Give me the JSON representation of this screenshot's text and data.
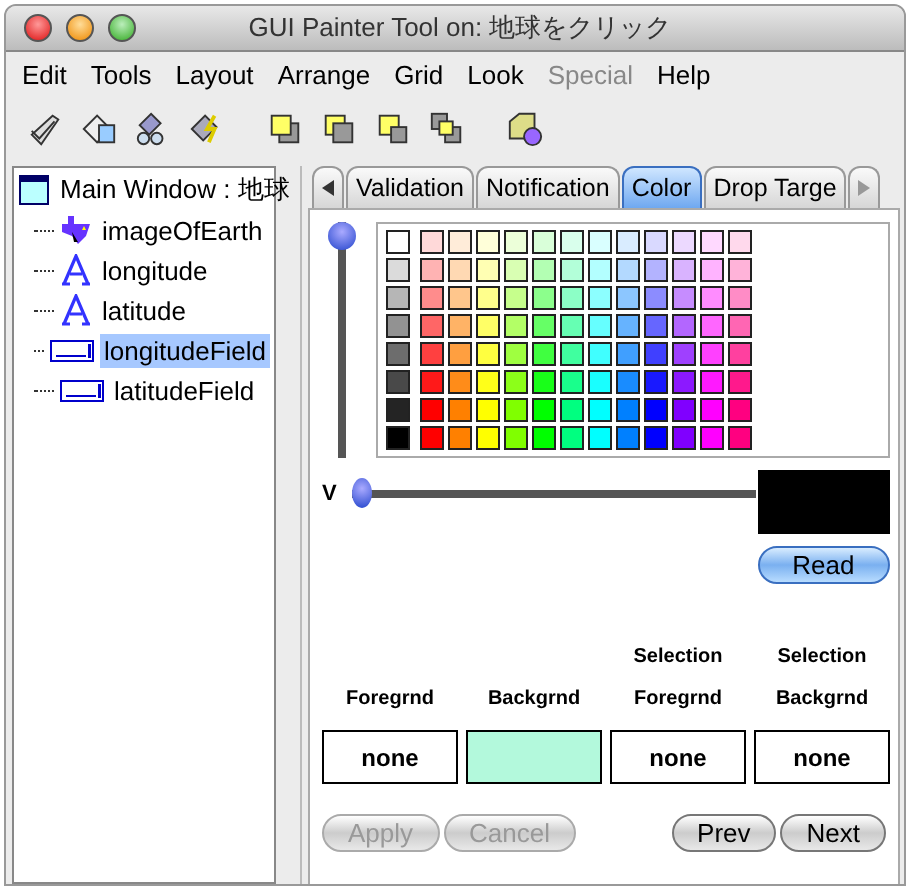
{
  "window": {
    "title": "GUI Painter Tool on: 地球をクリック"
  },
  "menu": [
    {
      "label": "Edit",
      "disabled": false
    },
    {
      "label": "Tools",
      "disabled": false
    },
    {
      "label": "Layout",
      "disabled": false
    },
    {
      "label": "Arrange",
      "disabled": false
    },
    {
      "label": "Grid",
      "disabled": false
    },
    {
      "label": "Look",
      "disabled": false
    },
    {
      "label": "Special",
      "disabled": true
    },
    {
      "label": "Help",
      "disabled": false
    }
  ],
  "tree": [
    {
      "label": "Main Window : 地球",
      "kind": "window",
      "selected": false,
      "children": [
        {
          "label": "imageOfEarth",
          "kind": "image",
          "selected": false
        },
        {
          "label": "longitude",
          "kind": "label",
          "selected": false
        },
        {
          "label": "latitude",
          "kind": "label",
          "selected": false
        },
        {
          "label": "longitudeField",
          "kind": "field",
          "selected": true
        },
        {
          "label": "latitudeField",
          "kind": "field",
          "selected": false
        }
      ]
    }
  ],
  "tabs": [
    {
      "label": "Validation",
      "selected": false
    },
    {
      "label": "Notification",
      "selected": false
    },
    {
      "label": "Color",
      "selected": true
    },
    {
      "label": "Drop Targe",
      "selected": false
    }
  ],
  "color_editor": {
    "saturation_slider": {
      "level": 1
    },
    "value_label": "V",
    "value_slider": {
      "level": 0
    },
    "preview": {
      "color": "#000000"
    },
    "read_button": "Read"
  },
  "color_slots": [
    {
      "label": "Foregrnd",
      "kind": "text",
      "value": "none"
    },
    {
      "label": "Backgrnd",
      "kind": "swatch",
      "color": "#b3f9dc"
    },
    {
      "label_top": "Selection",
      "label": "Foregrnd",
      "kind": "text",
      "value": "none"
    },
    {
      "label_top": "Selection",
      "label": "Backgrnd",
      "kind": "text",
      "value": "none"
    }
  ],
  "buttons": [
    {
      "label": "Apply",
      "disabled": true
    },
    {
      "label": "Cancel",
      "disabled": true
    },
    {
      "label": "Prev",
      "disabled": false
    },
    {
      "label": "Next",
      "disabled": false
    }
  ]
}
